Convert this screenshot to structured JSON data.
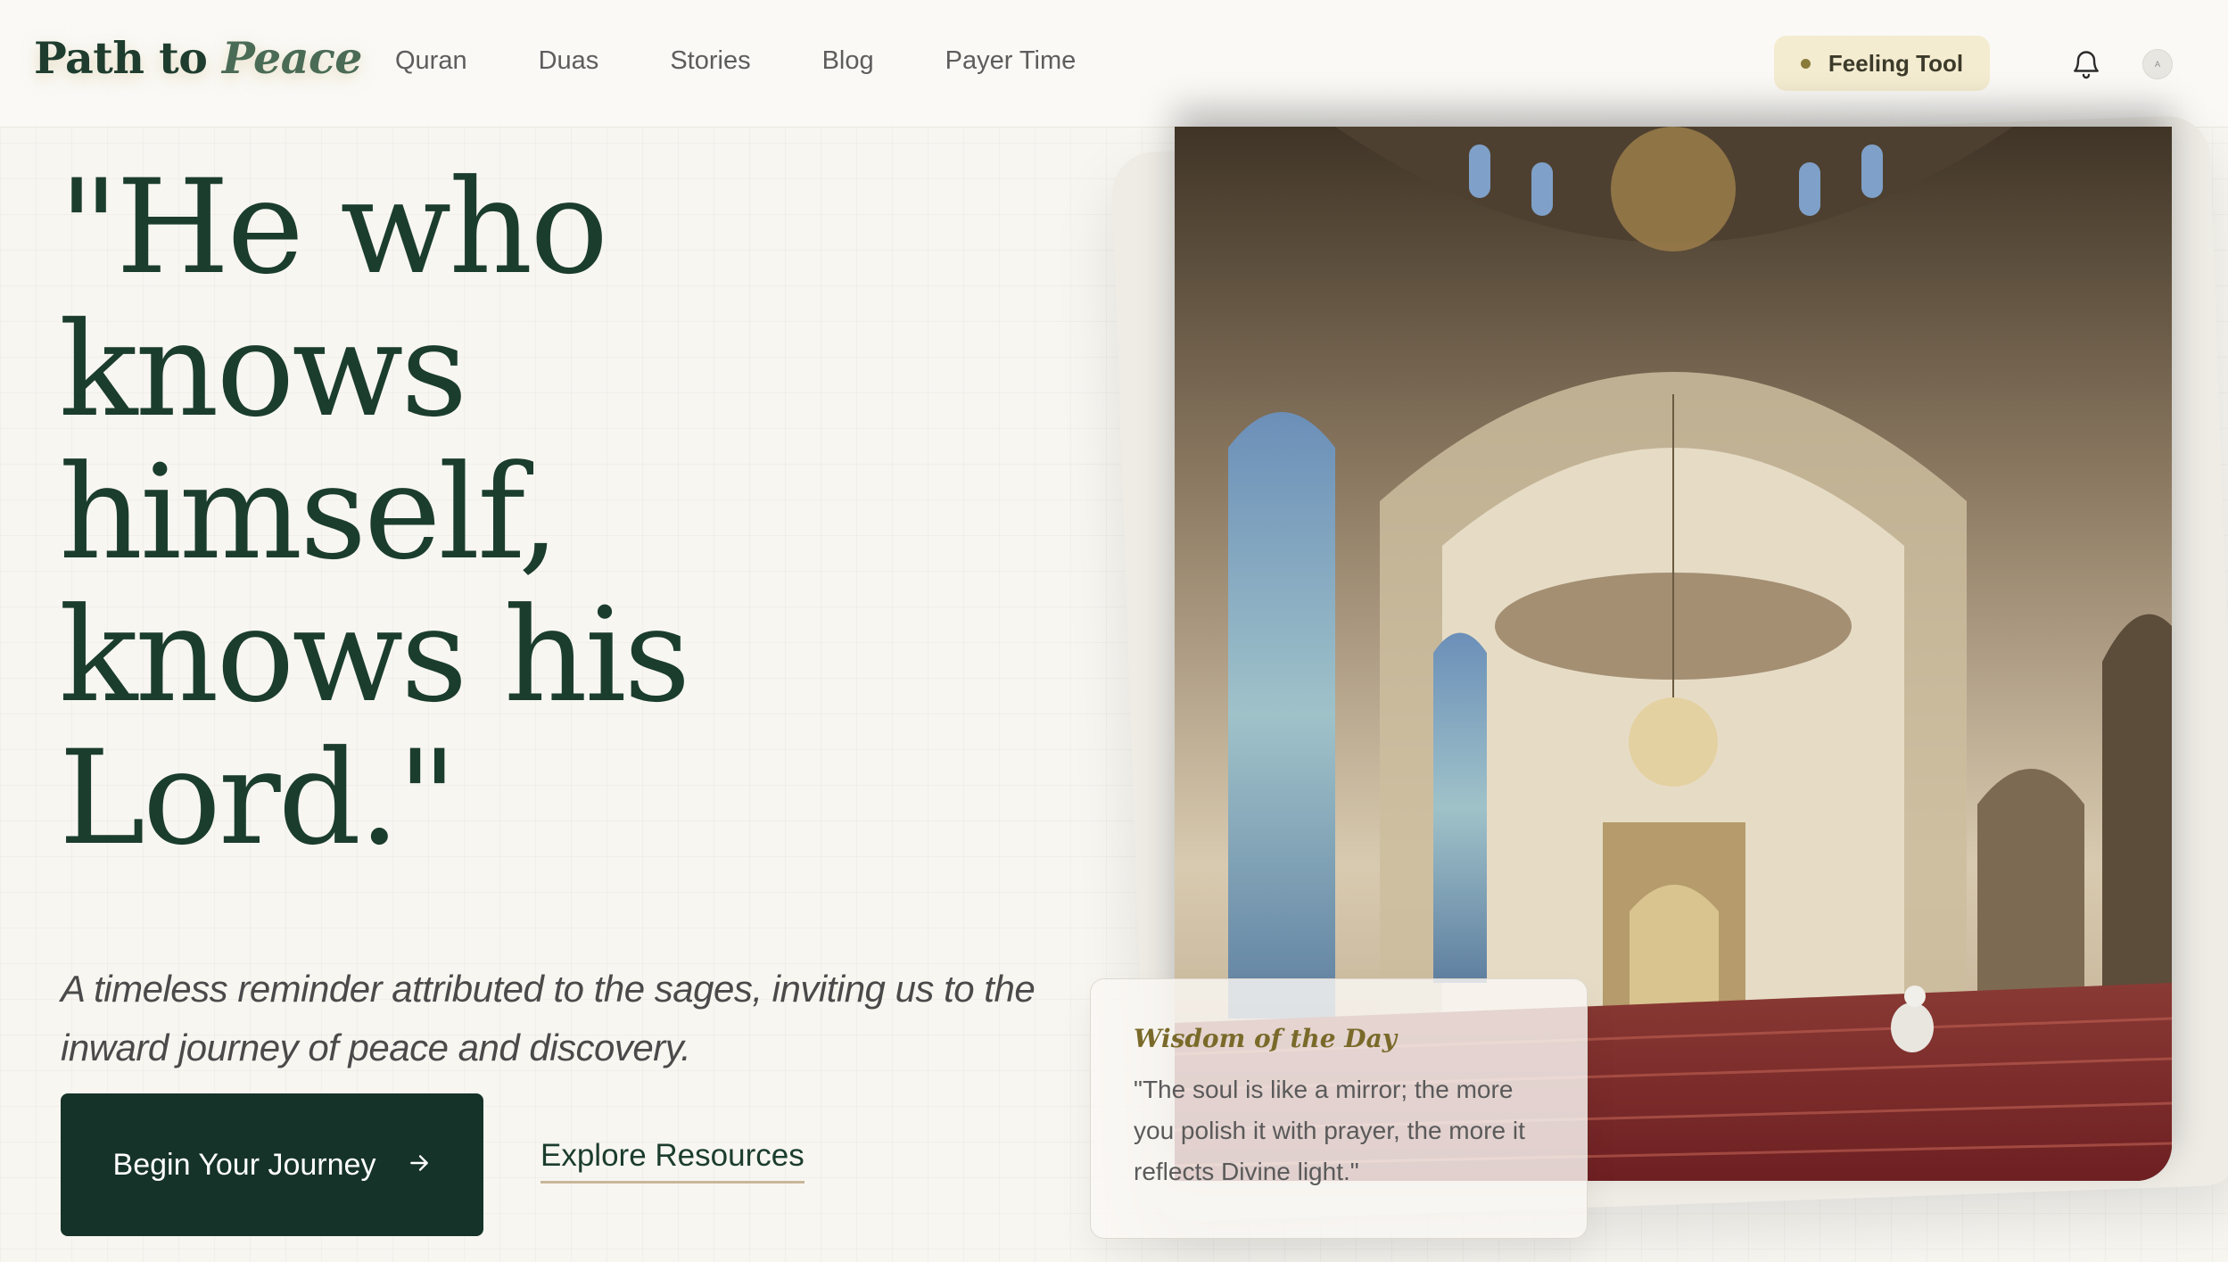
{
  "brand": {
    "name": "Path to",
    "accent": "Peace"
  },
  "nav": [
    "Quran",
    "Duas",
    "Stories",
    "Blog",
    "Payer Time"
  ],
  "header_actions": {
    "feeling_tool": "Feeling Tool",
    "avatar_text": "A"
  },
  "hero": {
    "quote_lines": [
      "\"He who",
      "knows",
      "himself,",
      "knows his",
      "Lord.\""
    ],
    "subtitle": "A timeless reminder attributed to the sages, inviting us to the inward journey of peace and discovery.",
    "primary_cta": "Begin Your Journey",
    "primary_cta_icon": "arrow-right-icon",
    "secondary_cta": "Explore Resources"
  },
  "wisdom": {
    "title": "Wisdom of the Day",
    "text": "\"The soul is like a mirror; the more you polish it with prayer, the more it reflects Divine light.\""
  },
  "colors": {
    "primary": "#163329",
    "heading": "#1b3d2e",
    "background": "#f8f6f1",
    "feeling_bg": "#f4ecd0",
    "accent_gold": "#7a6a2a"
  }
}
